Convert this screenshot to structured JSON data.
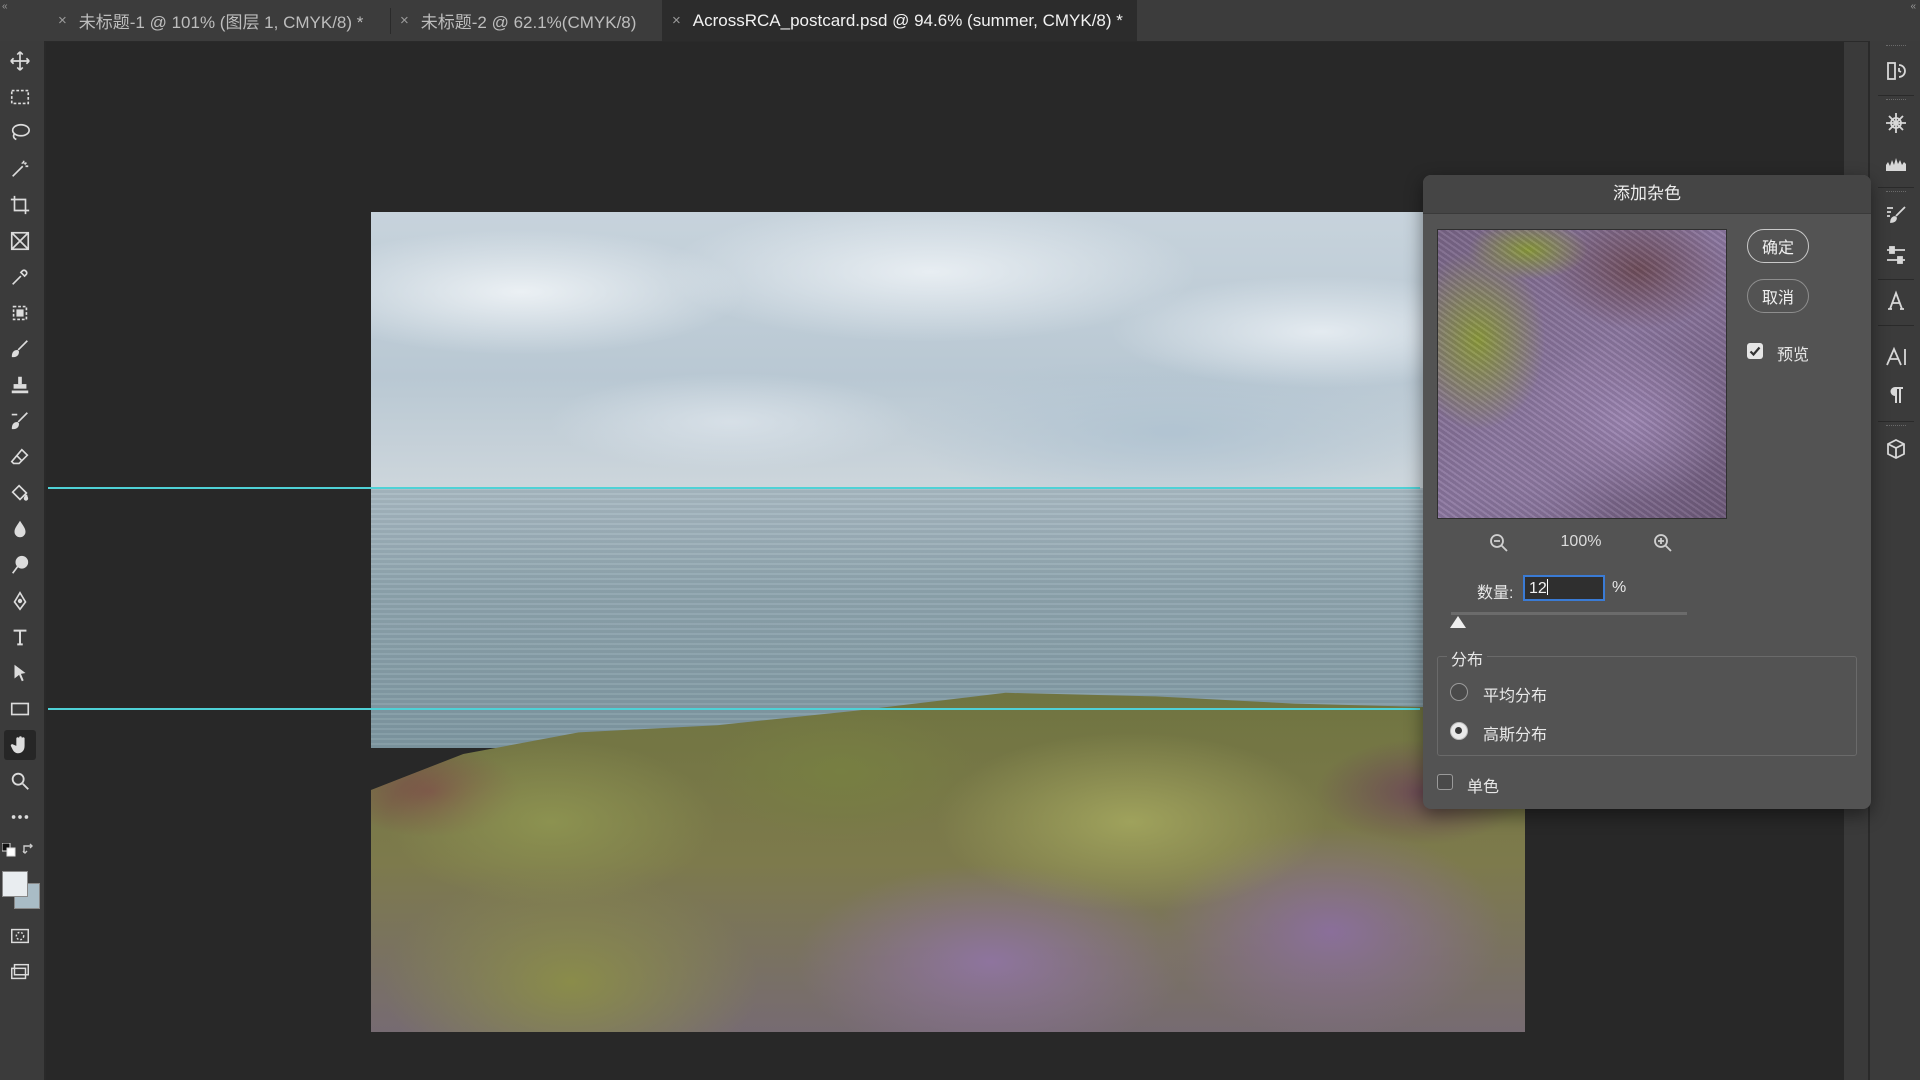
{
  "tabs": [
    {
      "title": "未标题-1 @ 101% (图层 1, CMYK/8) *",
      "active": false
    },
    {
      "title": "未标题-2 @ 62.1%(CMYK/8)",
      "active": false
    },
    {
      "title": "AcrossRCA_postcard.psd @ 94.6% (summer, CMYK/8) *",
      "active": true
    }
  ],
  "tab_close_glyph": "×",
  "panel_collapse_left": "«",
  "panel_collapse_right": "«",
  "toolbar": {
    "tools": [
      "move-tool",
      "rectangular-marquee-tool",
      "lasso-tool",
      "magic-wand-tool",
      "crop-tool",
      "frame-tool",
      "eyedropper-tool",
      "object-selection-tool",
      "brush-tool",
      "clone-stamp-tool",
      "history-brush-tool",
      "eraser-tool",
      "paint-bucket-tool",
      "blur-tool",
      "dodge-tool",
      "pen-tool",
      "type-tool",
      "path-selection-tool",
      "rectangle-tool",
      "hand-tool",
      "zoom-tool",
      "more-tools"
    ],
    "active_tool": "hand-tool",
    "foreground_color": "#e9edf0",
    "background_color": "#a9bcc6"
  },
  "right_panel": {
    "icons": [
      "history-icon",
      "navigator-icon",
      "histogram-icon",
      "brushes-icon",
      "adjustments-icon",
      "glyphs-icon",
      "character-icon",
      "paragraph-icon",
      "3d-icon"
    ]
  },
  "guides_color": "#4fd1d6",
  "dialog": {
    "title": "添加杂色",
    "ok_label": "确定",
    "cancel_label": "取消",
    "preview_label": "预览",
    "preview_checked": true,
    "zoom_level": "100%",
    "amount_label": "数量:",
    "amount_value": "12",
    "amount_unit": "%",
    "amount_slider_fraction": 0.03,
    "distribution_label": "分布",
    "distribution_options": [
      {
        "label": "平均分布",
        "selected": false
      },
      {
        "label": "高斯分布",
        "selected": true
      }
    ],
    "monochromatic_label": "单色",
    "monochromatic_checked": false
  }
}
